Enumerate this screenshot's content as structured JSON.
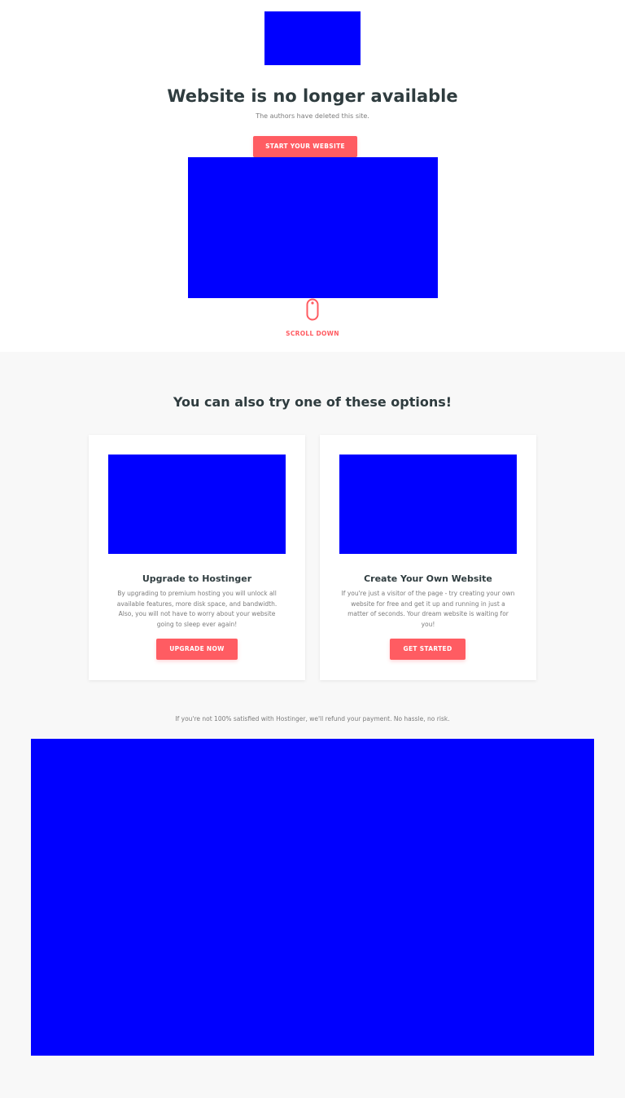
{
  "hero": {
    "title": "Website is no longer available",
    "subtitle": "The authors have deleted this site.",
    "cta_label": "START YOUR WEBSITE",
    "scroll_label": "SCROLL DOWN"
  },
  "options": {
    "title": "You can also try one of these options!",
    "cards": [
      {
        "title": "Upgrade to Hostinger",
        "text": "By upgrading to premium hosting you will unlock all available features, more disk space, and bandwidth. Also, you will not have to worry about your website going to sleep ever again!",
        "button_label": "UPGRADE NOW"
      },
      {
        "title": "Create Your Own Website",
        "text": "If you're just a visitor of the page - try creating your own website for free and get it up and running in just a matter of seconds. Your dream website is waiting for you!",
        "button_label": "GET STARTED"
      }
    ],
    "refund_note": "If you're not 100% satisfied with Hostinger, we'll refund your payment. No hassle, no risk."
  },
  "colors": {
    "accent": "#ff5c62",
    "heading": "#2f3c3f",
    "muted_text": "#7c7c7c",
    "placeholder": "#0000ff",
    "section_background": "#f8f8f8"
  },
  "icons": {
    "scroll": "mouse-icon"
  }
}
